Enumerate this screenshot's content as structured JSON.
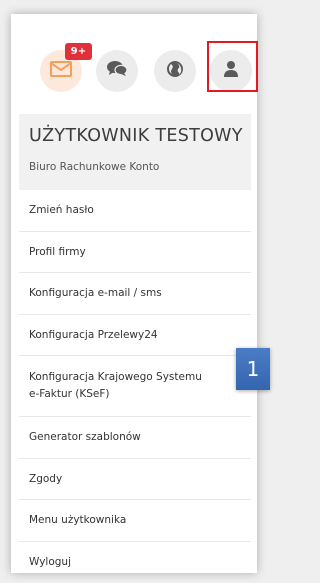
{
  "notifications": {
    "badge": "9+"
  },
  "icons": [
    "mail-icon",
    "chat-icon",
    "globe-icon",
    "user-icon"
  ],
  "user": {
    "name": "UŻYTKOWNIK TESTOWY",
    "company": "Biuro Rachunkowe Konto"
  },
  "menu": {
    "items": [
      "Zmień hasło",
      "Profil firmy",
      "Konfiguracja e-mail / sms",
      "Konfiguracja Przelewy24",
      "Konfiguracja Krajowego Systemu e-Faktur (KSeF)",
      "Generator szablonów",
      "Zgody",
      "Menu użytkownika",
      "Wyloguj"
    ]
  },
  "marker": {
    "label": "1"
  },
  "colors": {
    "badge": "#e0313b",
    "mail_icon": "#f4a05a",
    "icon_gray": "#5a5a5a",
    "highlight": "#e01b24",
    "marker": "#3f6fbb"
  }
}
